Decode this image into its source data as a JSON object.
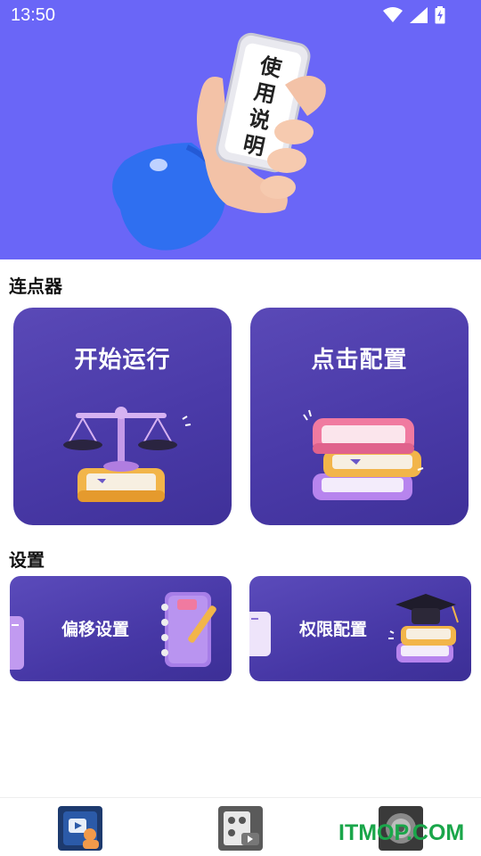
{
  "status_bar": {
    "time": "13:50"
  },
  "hero": {
    "phone_lines": [
      "使",
      "用",
      "说",
      "明"
    ],
    "background": "#6a66f7"
  },
  "sections": {
    "clicker_title": "连点器",
    "settings_title": "设置"
  },
  "cards": {
    "start": {
      "title": "开始运行"
    },
    "config": {
      "title": "点击配置"
    },
    "offset": {
      "title": "偏移设置"
    },
    "permission": {
      "title": "权限配置"
    }
  },
  "bottom_nav": {
    "items": [
      {
        "icon": "video-person-icon"
      },
      {
        "icon": "contacts-video-icon"
      },
      {
        "icon": "dial-icon"
      }
    ]
  },
  "watermark": "ITMOP.COM"
}
